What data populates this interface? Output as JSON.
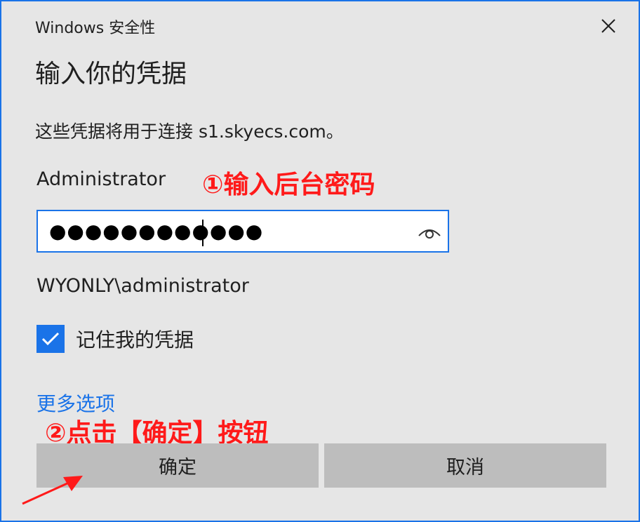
{
  "window": {
    "title": "Windows 安全性",
    "close_icon": "close-icon"
  },
  "dialog": {
    "heading": "输入你的凭据",
    "description": "这些凭据将用于连接 s1.skyecs.com。",
    "username": "Administrator",
    "password": {
      "masked_value": "●●●●●●●●●●●●",
      "reveal_icon": "eye-icon"
    },
    "domain_user": "WYONLY\\administrator",
    "remember": {
      "label": "记住我的凭据",
      "checked": true
    },
    "more_options": "更多选项",
    "buttons": {
      "ok": "确定",
      "cancel": "取消"
    }
  },
  "annotations": {
    "step1": "①输入后台密码",
    "step2": "②点击【确定】按钮",
    "color": "#ff1a1a"
  },
  "colors": {
    "accent": "#1a73e8",
    "background": "#e6e6e6",
    "button": "#bdbdbd"
  }
}
